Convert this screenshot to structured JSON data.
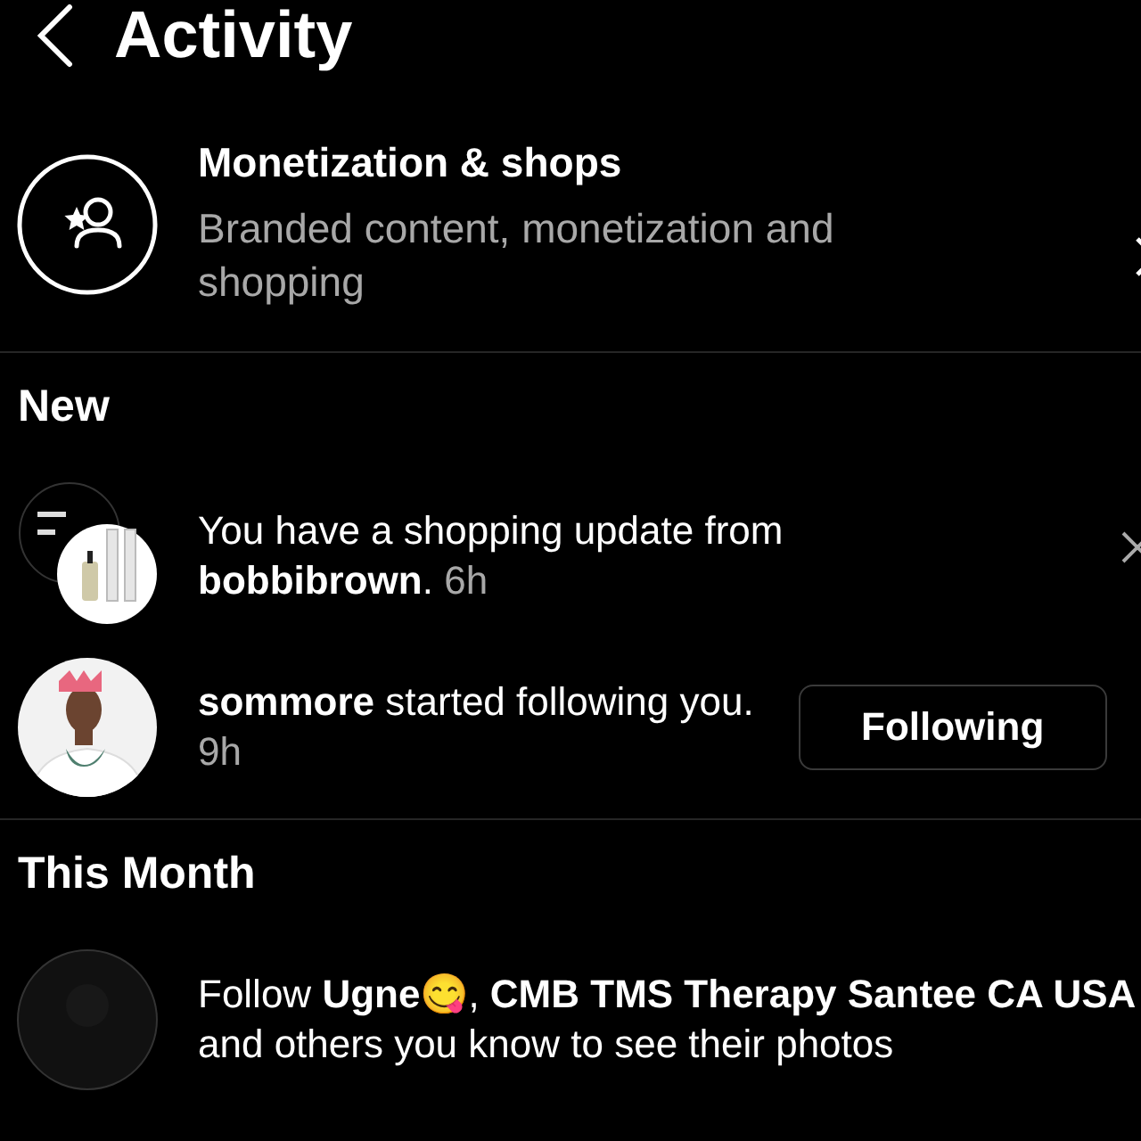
{
  "header": {
    "title": "Activity"
  },
  "settings_item": {
    "title": "Monetization & shops",
    "subtitle": "Branded content, monetization and shopping"
  },
  "sections": [
    {
      "title": "New",
      "items": [
        {
          "kind": "shopping",
          "text": "You have a shopping update from **bobbibrown**.",
          "time": "6h"
        },
        {
          "kind": "follow",
          "text": "**sommore** started following you.",
          "time": "9h",
          "button": "Following"
        }
      ]
    },
    {
      "title": "This Month",
      "items": [
        {
          "kind": "suggestion",
          "text": "Follow **Ugne😋**, **CMB TMS Therapy Santee CA USA** and others you know to see their photos"
        }
      ]
    }
  ]
}
